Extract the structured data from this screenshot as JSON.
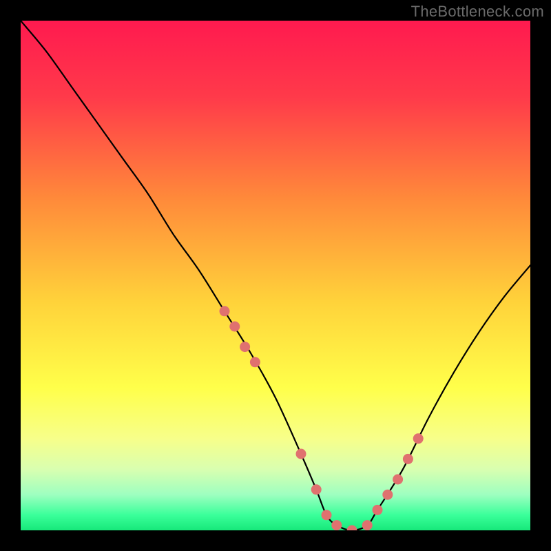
{
  "watermark": "TheBottleneck.com",
  "chart_data": {
    "type": "line",
    "title": "",
    "xlabel": "",
    "ylabel": "",
    "xlim": [
      0,
      100
    ],
    "ylim": [
      0,
      100
    ],
    "series": [
      {
        "name": "bottleneck-curve",
        "x": [
          0,
          5,
          10,
          15,
          20,
          25,
          30,
          35,
          40,
          45,
          50,
          55,
          58,
          60,
          62,
          65,
          68,
          70,
          75,
          80,
          85,
          90,
          95,
          100
        ],
        "values": [
          100,
          94,
          87,
          80,
          73,
          66,
          58,
          51,
          43,
          35,
          26,
          15,
          8,
          3,
          1,
          0,
          1,
          4,
          12,
          22,
          31,
          39,
          46,
          52
        ]
      }
    ],
    "markers": {
      "name": "highlight-points",
      "color": "#e0716f",
      "x": [
        40,
        42,
        44,
        46,
        55,
        58,
        60,
        62,
        65,
        68,
        70,
        72,
        74,
        76,
        78
      ],
      "values": [
        43,
        40,
        36,
        33,
        15,
        8,
        3,
        1,
        0,
        1,
        4,
        7,
        10,
        14,
        18
      ]
    },
    "background_gradient": {
      "type": "vertical",
      "stops": [
        {
          "offset": 0.0,
          "color": "#ff1a4f"
        },
        {
          "offset": 0.15,
          "color": "#ff3a4a"
        },
        {
          "offset": 0.35,
          "color": "#ff8a3a"
        },
        {
          "offset": 0.55,
          "color": "#ffd23a"
        },
        {
          "offset": 0.72,
          "color": "#ffff4a"
        },
        {
          "offset": 0.82,
          "color": "#f7ff8a"
        },
        {
          "offset": 0.88,
          "color": "#d9ffb0"
        },
        {
          "offset": 0.93,
          "color": "#9effc0"
        },
        {
          "offset": 0.97,
          "color": "#3aff9a"
        },
        {
          "offset": 1.0,
          "color": "#17e87a"
        }
      ]
    }
  }
}
